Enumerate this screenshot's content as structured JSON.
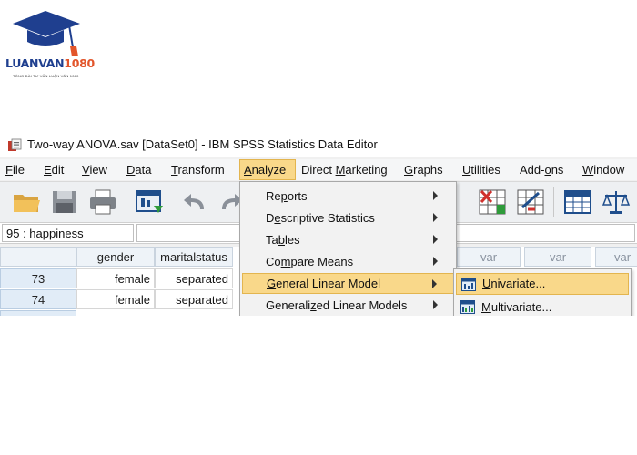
{
  "logo": {
    "name_main": "LUANVAN",
    "name_accent": "1080",
    "tagline": "TỔNG ĐÀI TƯ VẤN LUẬN VĂN 1080"
  },
  "window": {
    "title": "Two-way ANOVA.sav [DataSet0] - IBM SPSS Statistics Data Editor"
  },
  "menubar": {
    "items": [
      "File",
      "Edit",
      "View",
      "Data",
      "Transform",
      "Analyze",
      "Direct Marketing",
      "Graphs",
      "Utilities",
      "Add-ons",
      "Window"
    ],
    "active": "Analyze"
  },
  "toolbar": {
    "icons": [
      "open-folder-icon",
      "save-icon",
      "print-icon",
      "dialog-recall-icon",
      "undo-icon",
      "redo-icon",
      "split-file-icon",
      "select-cases-icon",
      "value-labels-icon",
      "weight-cases-icon"
    ]
  },
  "cell_editor": {
    "reference": "95 : happiness",
    "value": ""
  },
  "grid": {
    "columns": [
      "gender",
      "maritalstatus"
    ],
    "empty_columns": [
      "var",
      "var",
      "var"
    ],
    "rows": [
      {
        "id": "73",
        "gender": "female",
        "maritalstatus": "separated"
      },
      {
        "id": "74",
        "gender": "female",
        "maritalstatus": "separated"
      }
    ]
  },
  "analyze_menu": {
    "items": [
      {
        "label": "Reports",
        "submenu": true
      },
      {
        "label": "Descriptive Statistics",
        "submenu": true
      },
      {
        "label": "Tables",
        "submenu": true
      },
      {
        "label": "Compare Means",
        "submenu": true
      },
      {
        "label": "General Linear Model",
        "submenu": true,
        "active": true
      },
      {
        "label": "Generalized Linear Models",
        "submenu": true
      }
    ]
  },
  "glm_submenu": {
    "items": [
      {
        "label": "Univariate...",
        "icon": "univariate-icon",
        "active": true
      },
      {
        "label": "Multivariate...",
        "icon": "multivariate-icon",
        "active": false
      }
    ]
  },
  "colors": {
    "highlight": "#f9d88a",
    "highlight_border": "#e3b54f",
    "logo_blue": "#1f3f8f",
    "logo_orange": "#e2552b"
  }
}
